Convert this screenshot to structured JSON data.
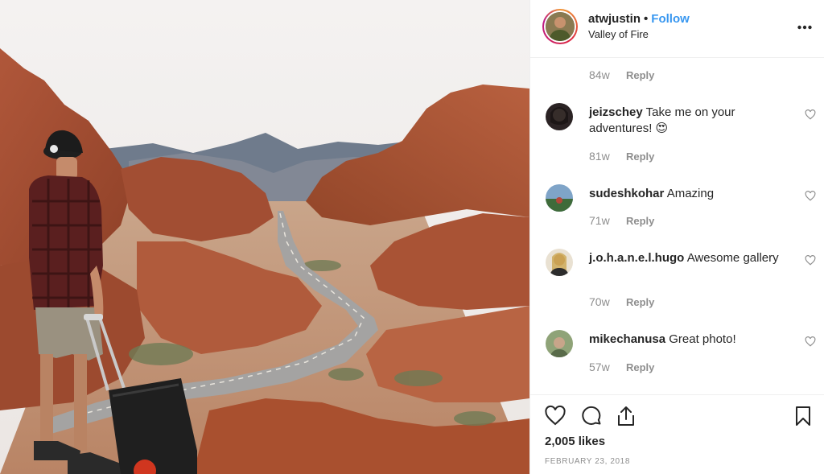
{
  "post": {
    "username": "atwjustin",
    "separator": "•",
    "follow_label": "Follow",
    "location": "Valley of Fire",
    "more_icon": "more-horizontal-icon"
  },
  "comments": {
    "top_meta": {
      "age": "84w",
      "reply_label": "Reply"
    },
    "items": [
      {
        "username": "jeizschey",
        "text": "Take me on your adventures! 😍",
        "age": "81w",
        "reply_label": "Reply"
      },
      {
        "username": "sudeshkohar",
        "text": "Amazing",
        "age": "71w",
        "reply_label": "Reply"
      },
      {
        "username": "j.o.h.a.n.e.l.hugo",
        "text": "Awesome gallery",
        "age": "70w",
        "reply_label": "Reply"
      },
      {
        "username": "mikechanusa",
        "text": "Great photo!",
        "age": "57w",
        "reply_label": "Reply"
      }
    ]
  },
  "actions": {
    "icons": [
      "heart-icon",
      "comment-icon",
      "share-icon",
      "bookmark-icon"
    ]
  },
  "stats": {
    "likes": "2,005 likes",
    "date": "FEBRUARY 23, 2018"
  },
  "colors": {
    "follow_blue": "#3897f0",
    "text": "#262626",
    "muted": "#8e8e8e",
    "border": "#efefef"
  }
}
